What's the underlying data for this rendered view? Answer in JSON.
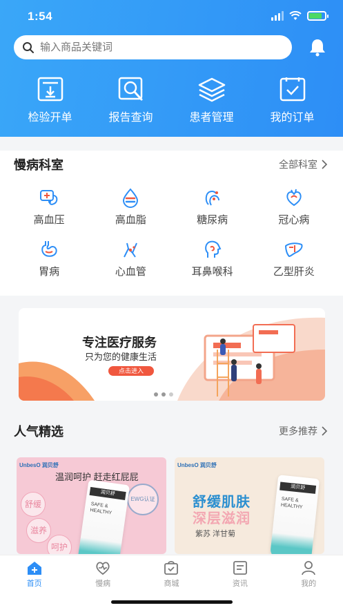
{
  "status_bar": {
    "time": "1:54"
  },
  "search": {
    "placeholder": "输入商品关键词"
  },
  "quick_actions": [
    {
      "label": "检验开单",
      "icon": "download-form-icon"
    },
    {
      "label": "报告查询",
      "icon": "search-report-icon"
    },
    {
      "label": "患者管理",
      "icon": "layers-icon"
    },
    {
      "label": "我的订单",
      "icon": "order-check-icon"
    }
  ],
  "chronic": {
    "title": "慢病科室",
    "more": "全部科室",
    "items": [
      {
        "label": "高血压",
        "icon": "blood-pressure-icon"
      },
      {
        "label": "高血脂",
        "icon": "blood-lipid-icon"
      },
      {
        "label": "糖尿病",
        "icon": "diabetes-icon"
      },
      {
        "label": "冠心病",
        "icon": "heart-icon"
      },
      {
        "label": "胃病",
        "icon": "stomach-icon"
      },
      {
        "label": "心血管",
        "icon": "cardiovascular-icon"
      },
      {
        "label": "耳鼻喉科",
        "icon": "ent-icon"
      },
      {
        "label": "乙型肝炎",
        "icon": "liver-icon"
      }
    ]
  },
  "banner": {
    "title": "专注医疗服务",
    "subtitle": "只为您的健康生活",
    "button": "点击进入"
  },
  "popular": {
    "title": "人气精选",
    "more": "更多推荐",
    "products": [
      {
        "brand": "UnbesO 润贝舒",
        "slogan": "温润呵护 赶走红屁屁",
        "tags": [
          "舒缓",
          "滋养",
          "呵护"
        ],
        "seal": "EWG认证",
        "tube_label": "润贝舒",
        "tube_text": "SAFE & HEALTHY"
      },
      {
        "brand": "UnbesO 润贝舒",
        "line1": "舒缓肌肤",
        "line2": "深层滋润",
        "sub": "紫苏 洋甘菊",
        "tube_label": "润贝舒",
        "tube_text": "SAFE & HEALTHY"
      }
    ]
  },
  "tabbar": [
    {
      "label": "首页",
      "icon": "home-icon",
      "active": true
    },
    {
      "label": "慢病",
      "icon": "chronic-icon",
      "active": false
    },
    {
      "label": "商城",
      "icon": "shop-icon",
      "active": false
    },
    {
      "label": "资讯",
      "icon": "news-icon",
      "active": false
    },
    {
      "label": "我的",
      "icon": "profile-icon",
      "active": false
    }
  ],
  "colors": {
    "primary": "#2d8ef6",
    "accent_red": "#f0573e"
  }
}
